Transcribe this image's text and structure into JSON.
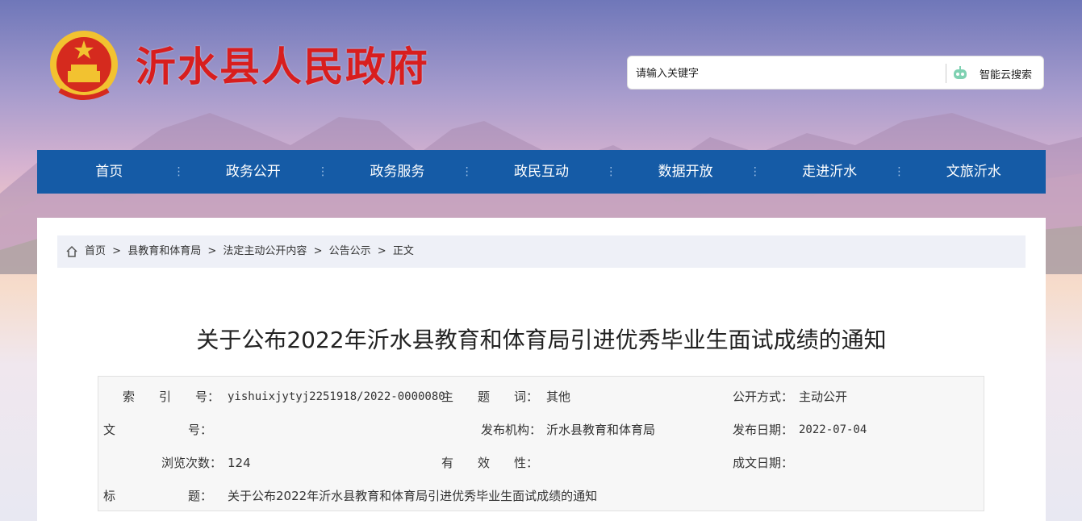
{
  "site": {
    "title": "沂水县人民政府"
  },
  "search": {
    "placeholder": "请输入关键字",
    "button_label": "智能云搜索"
  },
  "nav": {
    "items": [
      "首页",
      "政务公开",
      "政务服务",
      "政民互动",
      "数据开放",
      "走进沂水",
      "文旅沂水"
    ]
  },
  "breadcrumb": {
    "items": [
      "首页",
      ">",
      "县教育和体育局",
      ">",
      "法定主动公开内容",
      ">",
      "公告公示",
      ">",
      "正文"
    ]
  },
  "article": {
    "title": "关于公布2022年沂水县教育和体育局引进优秀毕业生面试成绩的通知"
  },
  "meta": {
    "index_label": "索　　引　　号：",
    "index_value": "yishuixjytyj2251918/2022-0000080",
    "subject_label": "主　　题　　词：",
    "subject_value": "其他",
    "open_mode_label": "公开方式：",
    "open_mode_value": "主动公开",
    "doc_no_label": "文　　　　　　号：",
    "doc_no_value": "",
    "publisher_label": "发布机构：",
    "publisher_value": "沂水县教育和体育局",
    "publish_date_label": "发布日期：",
    "publish_date_value": "2022-07-04",
    "views_label": "浏览次数：",
    "views_value": "124",
    "validity_label": "有　　效　　性：",
    "validity_value": "",
    "created_date_label": "成文日期：",
    "created_date_value": "",
    "title_label": "标　　　　　　题：",
    "title_value": "关于公布2022年沂水县教育和体育局引进优秀毕业生面试成绩的通知"
  },
  "colors": {
    "nav_bg": "#155ba6",
    "title_red": "#d81e1e"
  }
}
